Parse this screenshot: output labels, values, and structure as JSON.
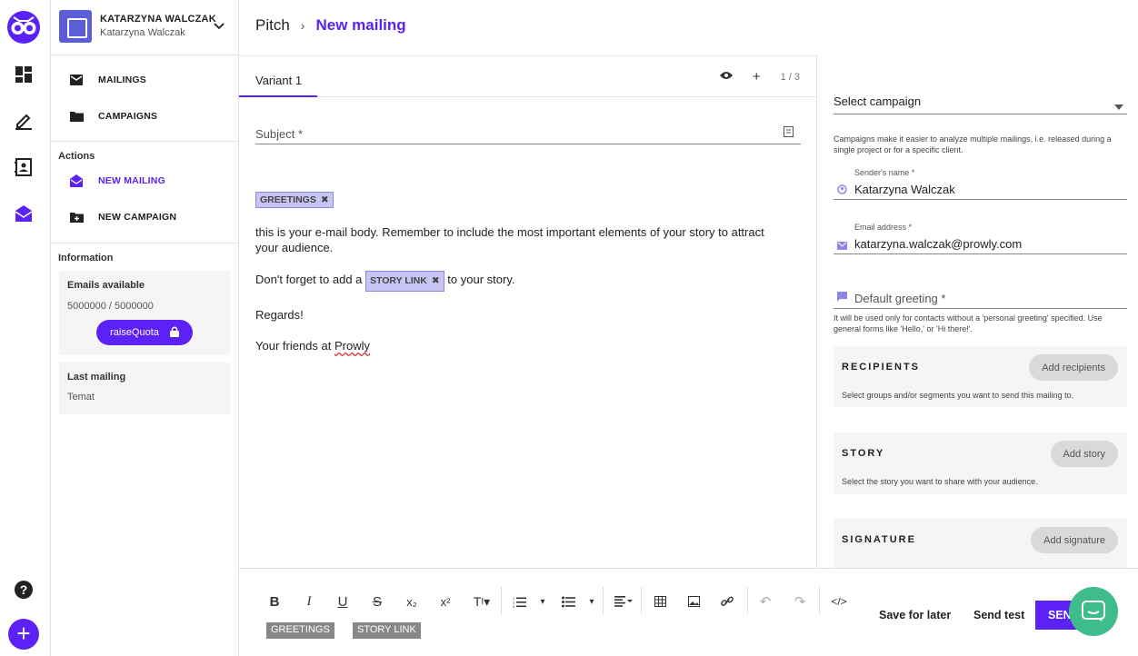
{
  "account": {
    "name": "KATARZYNA WALCZAK",
    "sub": "Katarzyna Walczak"
  },
  "rail": {
    "icons": [
      "owl-logo-icon",
      "dashboard-icon",
      "pencil-ruler-icon",
      "contacts-icon",
      "mailing-icon",
      "help-icon",
      "add-icon"
    ]
  },
  "menu": {
    "mailings": "MAILINGS",
    "campaigns": "CAMPAIGNS",
    "actions_title": "Actions",
    "new_mailing": "NEW MAILING",
    "new_campaign": "NEW CAMPAIGN",
    "info_title": "Information"
  },
  "info": {
    "emails_title": "Emails available",
    "emails_value": "5000000 / 5000000",
    "quota_button": "raiseQuota",
    "last_title": "Last mailing",
    "last_value": "Temat"
  },
  "header": {
    "crumb_root": "Pitch",
    "crumb_sep": "›",
    "crumb_current": "New mailing"
  },
  "editor": {
    "tab": "Variant 1",
    "variant_counter": "1 / 3",
    "subject_placeholder": "Subject *",
    "tag_greetings": "GREETINGS",
    "tag_story_link": "STORY LINK",
    "body_line1": "this is your e-mail body. Remember to include the most important elements of your story to attract your audience.",
    "body_line2_pre": "Don't forget to add a",
    "body_line2_post": "to your story.",
    "body_regards": "Regards!",
    "body_friends": "Your friends at",
    "body_brand": "Prowly"
  },
  "right": {
    "campaign_placeholder": "Select campaign",
    "campaign_hint": "Campaigns make it easier to analyze multiple mailings, i.e. released during a single project or for a specific client.",
    "sender_label": "Sender's name *",
    "sender_value": "Katarzyna Walczak",
    "email_label": "Email address *",
    "email_value": "katarzyna.walczak@prowly.com",
    "greeting_placeholder": "Default greeting *",
    "greeting_hint": "It will be used only for contacts without a 'personal greeting' specified. Use general forms like 'Hello,' or 'Hi there!'.",
    "recipients_title": "RECIPIENTS",
    "recipients_button": "Add recipients",
    "recipients_desc": "Select groups and/or segments you want to send this mailing to.",
    "story_title": "STORY",
    "story_button": "Add story",
    "story_desc": "Select the story you want to share with your audience.",
    "signature_title": "SIGNATURE",
    "signature_button": "Add signature"
  },
  "toolbar": {
    "chip_greetings": "GREETINGS",
    "chip_story_link": "STORY LINK",
    "save_later": "Save for later",
    "send_test": "Send test",
    "send": "SEND"
  },
  "colors": {
    "accent": "#5b21f5",
    "chat": "#3fbc8e"
  }
}
